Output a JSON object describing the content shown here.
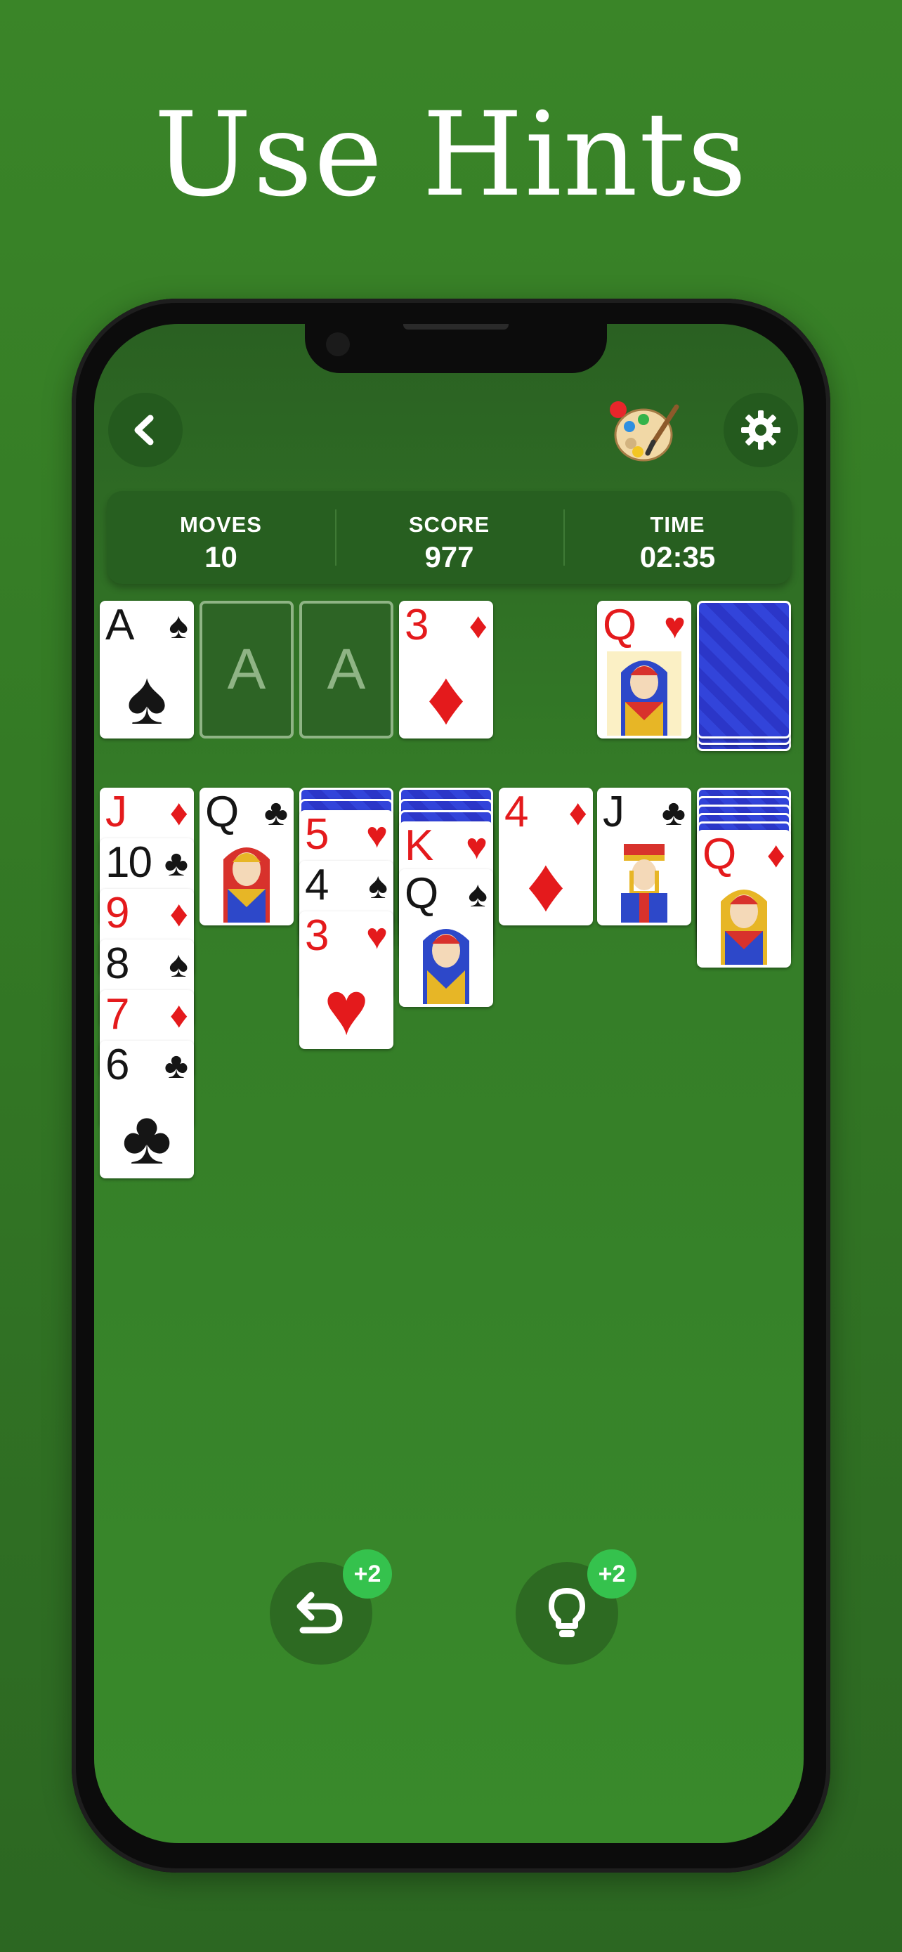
{
  "headline": "Use Hints",
  "header": {
    "back_icon": "chevron-left-icon",
    "theme_icon": "palette-icon",
    "settings_icon": "gear-icon"
  },
  "stats": {
    "moves_label": "MOVES",
    "moves_value": "10",
    "score_label": "SCORE",
    "score_value": "977",
    "time_label": "TIME",
    "time_value": "02:35"
  },
  "foundations": [
    {
      "rank": "A",
      "suit": "♠",
      "color": "black"
    },
    {
      "placeholder": "A"
    },
    {
      "placeholder": "A"
    },
    {
      "rank": "3",
      "suit": "♦",
      "color": "red"
    }
  ],
  "waste": {
    "rank": "Q",
    "suit": "♥",
    "color": "red"
  },
  "tableau": [
    {
      "hidden": 0,
      "cards": [
        {
          "rank": "J",
          "suit": "♦"
        },
        {
          "rank": "10",
          "suit": "♣"
        },
        {
          "rank": "9",
          "suit": "♦"
        },
        {
          "rank": "8",
          "suit": "♠"
        },
        {
          "rank": "7",
          "suit": "♦"
        },
        {
          "rank": "6",
          "suit": "♣"
        }
      ]
    },
    {
      "hidden": 0,
      "cards": [
        {
          "rank": "Q",
          "suit": "♣"
        }
      ]
    },
    {
      "hidden": 2,
      "cards": [
        {
          "rank": "5",
          "suit": "♥"
        },
        {
          "rank": "4",
          "suit": "♠"
        },
        {
          "rank": "3",
          "suit": "♥"
        }
      ]
    },
    {
      "hidden": 3,
      "cards": [
        {
          "rank": "K",
          "suit": "♥"
        },
        {
          "rank": "Q",
          "suit": "♠"
        }
      ]
    },
    {
      "hidden": 0,
      "cards": [
        {
          "rank": "4",
          "suit": "♦"
        }
      ]
    },
    {
      "hidden": 0,
      "cards": [
        {
          "rank": "J",
          "suit": "♣"
        }
      ]
    },
    {
      "hidden": 5,
      "cards": [
        {
          "rank": "Q",
          "suit": "♦"
        }
      ]
    }
  ],
  "controls": {
    "undo_icon": "undo-icon",
    "undo_badge": "+2",
    "hint_icon": "lightbulb-icon",
    "hint_badge": "+2"
  },
  "colors": {
    "red": "#e41a1c",
    "black": "#151515",
    "felt": "#398a2b",
    "badge": "#35c24d"
  }
}
